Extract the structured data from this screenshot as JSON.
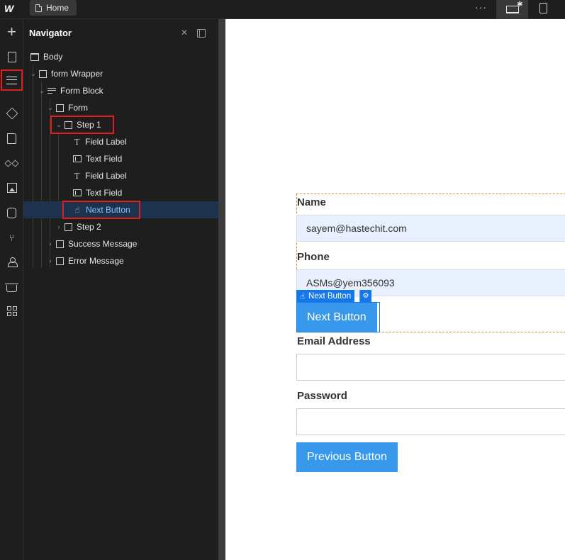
{
  "topbar": {
    "logo": "W",
    "tab_home": "Home",
    "more": "···",
    "desktop_star": "✱"
  },
  "navigator": {
    "title": "Navigator",
    "collapse_icon": "✕",
    "tree": [
      {
        "label": "Body"
      },
      {
        "label": "form Wrapper"
      },
      {
        "label": "Form Block"
      },
      {
        "label": "Form"
      },
      {
        "label": "Step 1"
      },
      {
        "label": "Field Label"
      },
      {
        "label": "Text Field"
      },
      {
        "label": "Field Label"
      },
      {
        "label": "Text Field"
      },
      {
        "label": "Next Button"
      },
      {
        "label": "Step 2"
      },
      {
        "label": "Success Message"
      },
      {
        "label": "Error Message"
      }
    ]
  },
  "canvas": {
    "name_label": "Name",
    "name_value": "sayem@hastechit.com",
    "phone_label": "Phone",
    "phone_value": "ASMs@yem356093",
    "next_button": "Next Button",
    "selection_badge": "Next Button",
    "email_label": "Email Address",
    "password_label": "Password",
    "previous_button": "Previous Button"
  },
  "colors": {
    "selection_blue": "#1677e8",
    "button_blue": "#3898ec",
    "highlight_red": "#e01e1e",
    "tree_selected_text": "#8ac1ff"
  },
  "icons": [
    "plus-icon",
    "page-icon",
    "navigator-icon",
    "cube-icon",
    "book-icon",
    "drops-icon",
    "image-icon",
    "database-icon",
    "tree-icon",
    "user-icon",
    "basket-icon",
    "apps-icon"
  ]
}
